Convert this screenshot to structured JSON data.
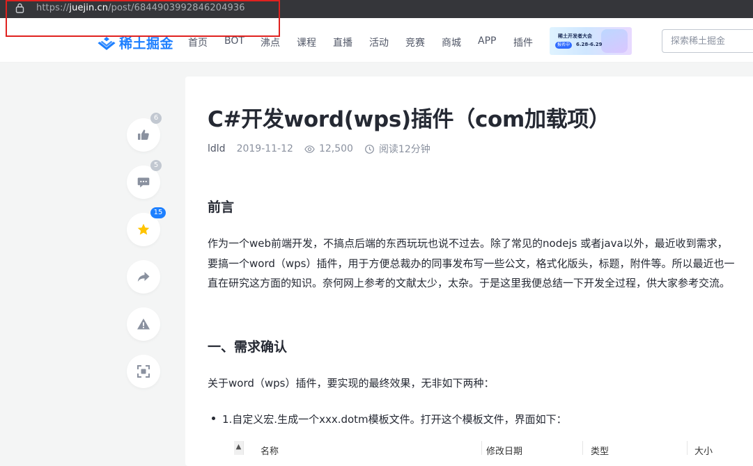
{
  "browser": {
    "url_prefix": "https://",
    "url_domain": "juejin.cn",
    "url_path": "/post/6844903992846204936"
  },
  "header": {
    "logo_text": "稀土掘金",
    "nav": [
      "首页",
      "BOT",
      "沸点",
      "课程",
      "直播",
      "活动",
      "竞赛",
      "商城",
      "APP",
      "插件"
    ],
    "banner": {
      "title": "稀土开发者大会",
      "pill": "报名中",
      "date": "6.28-6.29"
    },
    "search_placeholder": "探索稀土掘金"
  },
  "sidebar": {
    "like_count": "6",
    "comment_count": "5",
    "collect_count": "15"
  },
  "article": {
    "title": "C#开发word(wps)插件（com加载项）",
    "author": "ldld",
    "date": "2019-11-12",
    "views": "12,500",
    "read_time": "阅读12分钟",
    "section1_heading": "前言",
    "section1_body": "作为一个web前端开发，不搞点后端的东西玩玩也说不过去。除了常见的nodejs 或者java以外，最近收到需求，要搞一个word（wps）插件，用于方便总裁办的同事发布写一些公文，格式化版头，标题，附件等。所以最近也一直在研究这方面的知识。奈何网上参考的文献太少，太杂。于是这里我便总结一下开发全过程，供大家参考交流。",
    "section2_heading": "一、需求确认",
    "section2_body": "关于word（wps）插件，要实现的最终效果，无非如下两种：",
    "bullet1": "1.自定义宏.生成一个xxx.dotm模板文件。打开这个模板文件，界面如下："
  },
  "file_table": {
    "columns": [
      "名称",
      "修改日期",
      "类型",
      "大小"
    ]
  },
  "colors": {
    "brand": "#1e80ff",
    "annotation": "#e0211f",
    "star": "#ffc400"
  }
}
